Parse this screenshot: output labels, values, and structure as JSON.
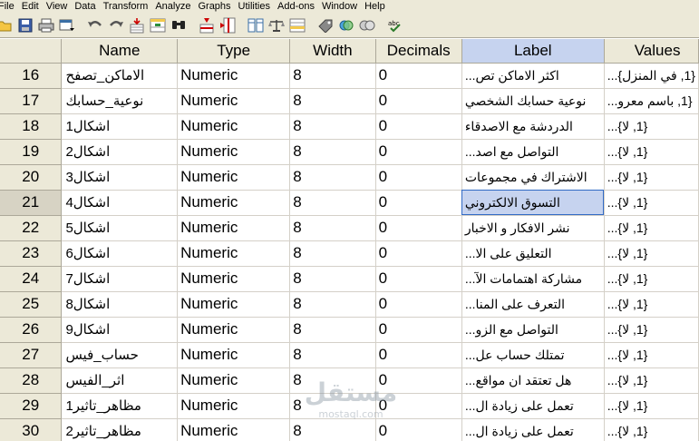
{
  "menu": [
    "File",
    "Edit",
    "View",
    "Data",
    "Transform",
    "Analyze",
    "Graphs",
    "Utilities",
    "Add-ons",
    "Window",
    "Help"
  ],
  "toolbar": {
    "icons": [
      "open-icon",
      "save-icon",
      "print-icon",
      "dialog-recall-icon",
      "undo-icon",
      "redo-icon",
      "goto-case-icon",
      "variables-icon",
      "find-icon",
      "insert-cases-icon",
      "insert-variable-icon",
      "split-file-icon",
      "weight-cases-icon",
      "select-cases-icon",
      "value-labels-icon",
      "use-sets-icon",
      "show-all-icon",
      "spell-check-icon"
    ]
  },
  "columns": [
    "Name",
    "Type",
    "Width",
    "Decimals",
    "Label",
    "Values"
  ],
  "rows": [
    {
      "num": "16",
      "name": "الاماكن_تصفح",
      "type": "Numeric",
      "width": "8",
      "decimals": "0",
      "label": "اكثر الاماكن تص...",
      "values": "{1, في المنزل}..."
    },
    {
      "num": "17",
      "name": "نوعية_حسابك",
      "type": "Numeric",
      "width": "8",
      "decimals": "0",
      "label": "نوعية حسابك الشخصي",
      "values": "{1, باسم معرو..."
    },
    {
      "num": "18",
      "name": "اشكال1",
      "type": "Numeric",
      "width": "8",
      "decimals": "0",
      "label": "الدردشة مع الاصدقاء",
      "values": "{1, لا}..."
    },
    {
      "num": "19",
      "name": "اشكال2",
      "type": "Numeric",
      "width": "8",
      "decimals": "0",
      "label": "التواصل مع اصد...",
      "values": "{1, لا}..."
    },
    {
      "num": "20",
      "name": "اشكال3",
      "type": "Numeric",
      "width": "8",
      "decimals": "0",
      "label": "الاشتراك في مجموعات",
      "values": "{1, لا}..."
    },
    {
      "num": "21",
      "name": "اشكال4",
      "type": "Numeric",
      "width": "8",
      "decimals": "0",
      "label": "التسوق الالكتروني",
      "values": "{1, لا}..."
    },
    {
      "num": "22",
      "name": "اشكال5",
      "type": "Numeric",
      "width": "8",
      "decimals": "0",
      "label": "نشر الافكار و الاخبار",
      "values": "{1, لا}..."
    },
    {
      "num": "23",
      "name": "اشكال6",
      "type": "Numeric",
      "width": "8",
      "decimals": "0",
      "label": "التعليق على الا...",
      "values": "{1, لا}..."
    },
    {
      "num": "24",
      "name": "اشكال7",
      "type": "Numeric",
      "width": "8",
      "decimals": "0",
      "label": "مشاركة اهتمامات الآ...",
      "values": "{1, لا}..."
    },
    {
      "num": "25",
      "name": "اشكال8",
      "type": "Numeric",
      "width": "8",
      "decimals": "0",
      "label": "التعرف على المنا...",
      "values": "{1, لا}..."
    },
    {
      "num": "26",
      "name": "اشكال9",
      "type": "Numeric",
      "width": "8",
      "decimals": "0",
      "label": "التواصل مع الزو...",
      "values": "{1, لا}..."
    },
    {
      "num": "27",
      "name": "حساب_فيس",
      "type": "Numeric",
      "width": "8",
      "decimals": "0",
      "label": "تمتلك حساب عل...",
      "values": "{1, لا}..."
    },
    {
      "num": "28",
      "name": "اثر_الفيس",
      "type": "Numeric",
      "width": "8",
      "decimals": "0",
      "label": "هل تعتقد ان مواقع...",
      "values": "{1, لا}..."
    },
    {
      "num": "29",
      "name": "مظاهر_تاثير1",
      "type": "Numeric",
      "width": "8",
      "decimals": "0",
      "label": "تعمل على زيادة ال...",
      "values": "{1, لا}..."
    },
    {
      "num": "30",
      "name": "مظاهر_تاثير2",
      "type": "Numeric",
      "width": "8",
      "decimals": "0",
      "label": "تعمل على زيادة ال...",
      "values": "{1, لا}..."
    }
  ],
  "selected": {
    "row_index": 5,
    "column": "label"
  },
  "watermark": {
    "text_ar": "مستقل",
    "text_en": "mostaql.com"
  },
  "colors": {
    "chrome": "#ece9d8",
    "selection": "#c6d3ef",
    "selection_border": "#316ac5"
  }
}
